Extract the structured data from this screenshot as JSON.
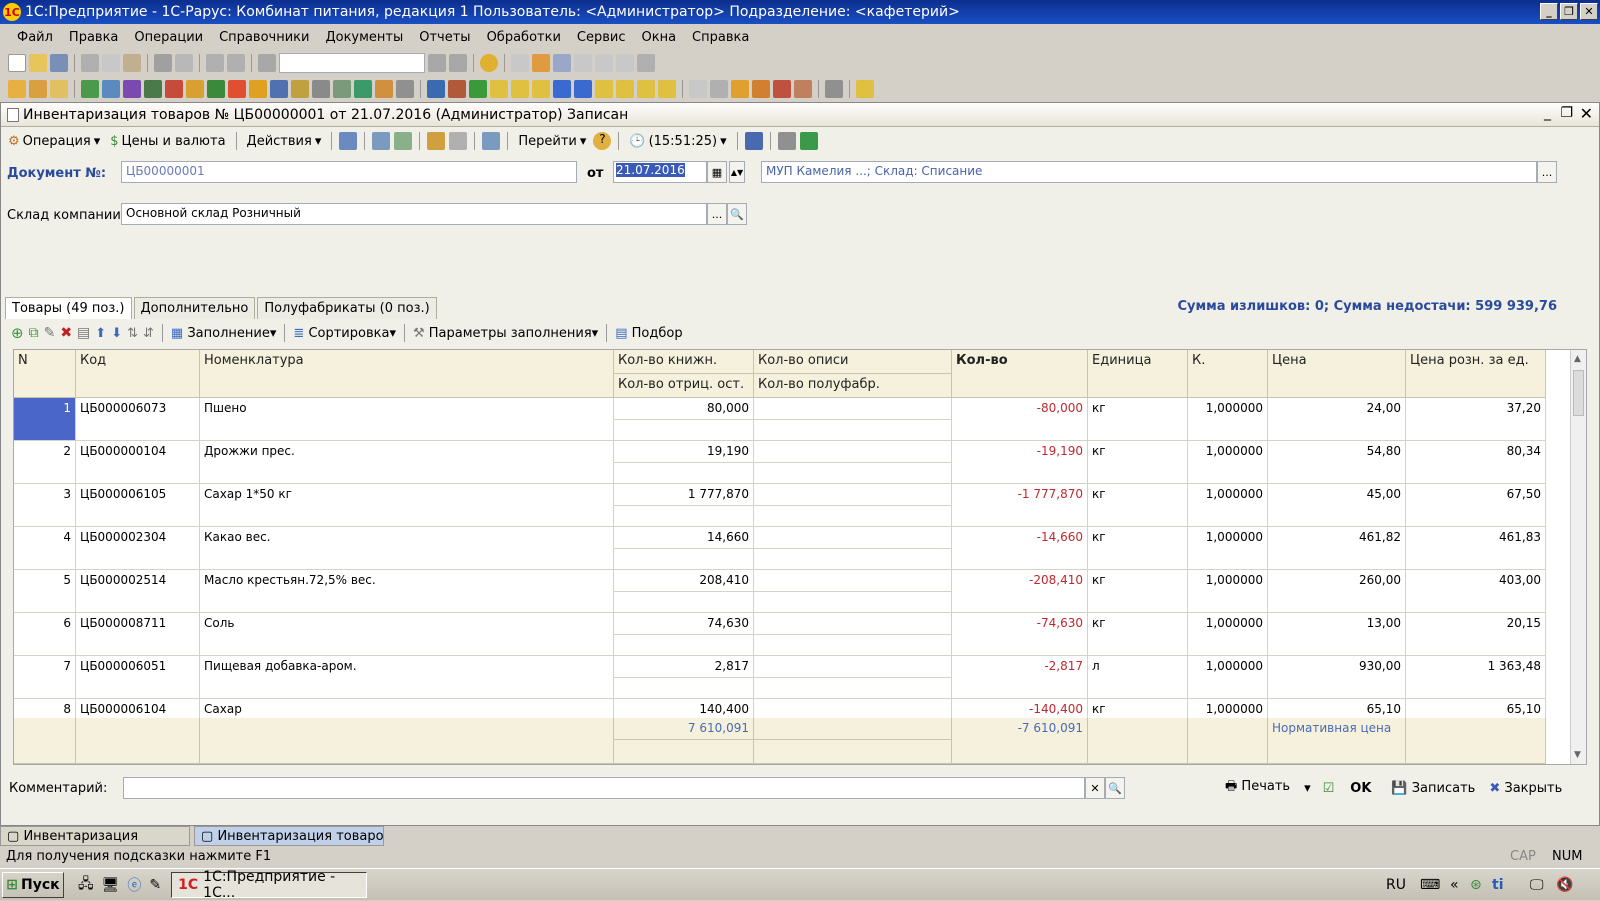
{
  "window": {
    "title": "1С:Предприятие - 1С-Рарус: Комбинат питания, редакция 1    Пользователь: <Администратор>    Подразделение: <кафетерий>"
  },
  "menu": [
    "Файл",
    "Правка",
    "Операции",
    "Справочники",
    "Документы",
    "Отчеты",
    "Обработки",
    "Сервис",
    "Окна",
    "Справка"
  ],
  "doc": {
    "title": "Инвентаризация товаров № ЦБ00000001 от 21.07.2016 (Администратор) Записан",
    "toolbar": {
      "operation": "Операция",
      "prices": "Цены и валюта",
      "actions": "Действия",
      "goto": "Перейти",
      "time": "(15:51:25)"
    },
    "number_label": "Документ №:",
    "number_value": "ЦБ00000001",
    "from_label": "от",
    "date_value": "21.07.2016",
    "org_value": "МУП Камелия         ...; Склад: Списание",
    "warehouse_label": "Склад компании:",
    "warehouse_value": "Основной склад Розничный",
    "tabs": [
      "Товары (49 поз.)",
      "Дополнительно",
      "Полуфабрикаты (0 поз.)"
    ],
    "summary": "Сумма излишков: 0; Сумма недостачи: 599 939,76",
    "table_toolbar": {
      "fill": "Заполнение",
      "sort": "Сортировка",
      "fill_params": "Параметры заполнения",
      "select": "Подбор"
    },
    "columns": {
      "n": "N",
      "code": "Код",
      "name": "Номенклатура",
      "qty_book": "Кол-во книжн.",
      "qty_neg": "Кол-во отриц. ост.",
      "qty_inv": "Кол-во описи",
      "qty_semi": "Кол-во полуфабр.",
      "qty": "Кол-во",
      "unit": "Единица",
      "k": "К.",
      "price": "Цена",
      "retail_price": "Цена розн. за ед."
    },
    "rows": [
      {
        "n": "1",
        "code": "ЦБ000006073",
        "name": "Пшено",
        "qty_book": "80,000",
        "qty": "-80,000",
        "unit": "кг",
        "k": "1,000000",
        "price": "24,00",
        "retail": "37,20"
      },
      {
        "n": "2",
        "code": "ЦБ000000104",
        "name": "Дрожжи прес.",
        "qty_book": "19,190",
        "qty": "-19,190",
        "unit": "кг",
        "k": "1,000000",
        "price": "54,80",
        "retail": "80,34"
      },
      {
        "n": "3",
        "code": "ЦБ000006105",
        "name": "Сахар 1*50 кг",
        "qty_book": "1 777,870",
        "qty": "-1 777,870",
        "unit": "кг",
        "k": "1,000000",
        "price": "45,00",
        "retail": "67,50"
      },
      {
        "n": "4",
        "code": "ЦБ000002304",
        "name": "Какао вес.",
        "qty_book": "14,660",
        "qty": "-14,660",
        "unit": "кг",
        "k": "1,000000",
        "price": "461,82",
        "retail": "461,83"
      },
      {
        "n": "5",
        "code": "ЦБ000002514",
        "name": "Масло крестьян.72,5% вес.",
        "qty_book": "208,410",
        "qty": "-208,410",
        "unit": "кг",
        "k": "1,000000",
        "price": "260,00",
        "retail": "403,00"
      },
      {
        "n": "6",
        "code": "ЦБ000008711",
        "name": "Соль",
        "qty_book": "74,630",
        "qty": "-74,630",
        "unit": "кг",
        "k": "1,000000",
        "price": "13,00",
        "retail": "20,15"
      },
      {
        "n": "7",
        "code": "ЦБ000006051",
        "name": "Пищевая добавка-аром.",
        "qty_book": "2,817",
        "qty": "-2,817",
        "unit": "л",
        "k": "1,000000",
        "price": "930,00",
        "retail": "1 363,48"
      },
      {
        "n": "8",
        "code": "ЦБ000006104",
        "name": "Сахар",
        "qty_book": "140,400",
        "qty": "-140,400",
        "unit": "кг",
        "k": "1,000000",
        "price": "65,10",
        "retail": "65,10"
      }
    ],
    "totals": {
      "qty_book": "7 610,091",
      "qty": "-7 610,091",
      "price_note": "Нормативная цена"
    },
    "comment_label": "Комментарий:",
    "buttons": {
      "print": "Печать",
      "ok": "OK",
      "save": "Записать",
      "close": "Закрыть"
    }
  },
  "window_tabs": [
    "Инвентаризация",
    "Инвентаризация товаро..."
  ],
  "status": {
    "hint": "Для получения подсказки нажмите F1",
    "cap": "CAP",
    "num": "NUM"
  },
  "taskbar": {
    "start": "Пуск",
    "item": "1С:Предприятие - 1С...",
    "lang": "RU"
  }
}
